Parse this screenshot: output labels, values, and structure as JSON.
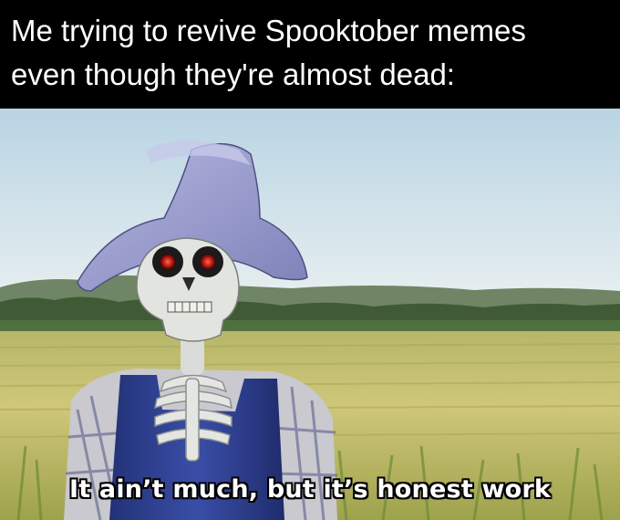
{
  "caption": {
    "line1": "Me trying to revive Spooktober memes",
    "line2": "even though they're almost dead:"
  },
  "image": {
    "bottom_text": "It ain’t much, but it’s honest work"
  },
  "colors": {
    "caption_background": "#000000",
    "caption_text": "#ffffff",
    "sky_top": "#b9d4e3",
    "sky_bottom": "#e3edf1",
    "field": "#c9c16a",
    "tree_line": "#3f5a34",
    "hat": "#9c9fd0",
    "overalls": "#2d3e92",
    "eyes": "#d4241e"
  }
}
